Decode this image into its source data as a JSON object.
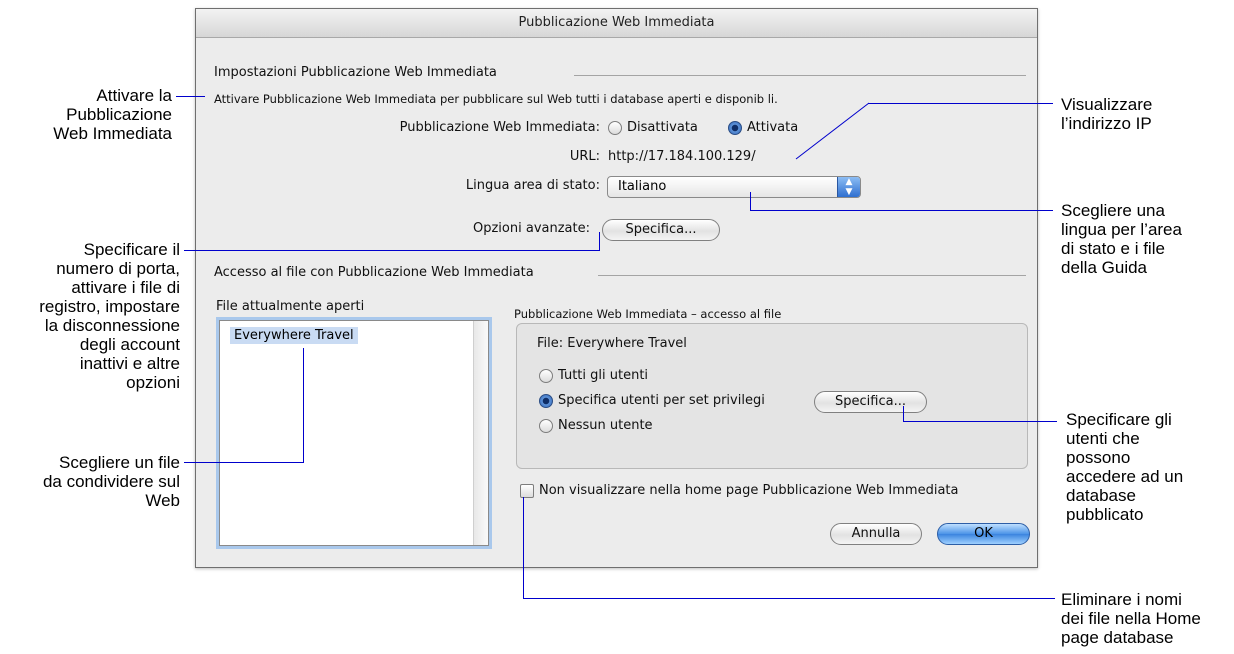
{
  "dialog": {
    "title": "Pubblicazione Web Immediata",
    "section1": {
      "heading": "Impostazioni Pubblicazione Web Immediata",
      "description": "Attivare Pubblicazione Web Immediata per pubblicare sul Web tutti i database aperti e disponib li.",
      "iwp_label": "Pubblicazione Web Immediata:",
      "off_label": "Disattivata",
      "on_label": "Attivata",
      "url_label": "URL:",
      "url_value": "http://17.184.100.129/",
      "language_label": "Lingua area di stato:",
      "language_value": "Italiano",
      "advanced_label": "Opzioni avanzate:",
      "specify_label": "Specifica..."
    },
    "section2": {
      "heading": "Accesso al file con Pubblicazione Web Immediata",
      "open_files_label": "File attualmente aperti",
      "files": [
        "Everywhere Travel"
      ],
      "group_title": "Pubblicazione Web Immediata – accesso al file",
      "file_label": "File: Everywhere Travel",
      "all_users": "Tutti gli utenti",
      "specify_users": "Specifica utenti per set privilegi",
      "specify_button": "Specifica...",
      "no_users": "Nessun utente",
      "hide_checkbox": "Non visualizzare nella home page Pubblicazione Web Immediata"
    },
    "buttons": {
      "cancel": "Annulla",
      "ok": "OK"
    }
  },
  "annotations": {
    "enable": "Attivare la\nPubblicazione\nWeb Immediata",
    "port": "Specificare il\nnumero di porta,\nattivare i file di\nregistro, impostare\nla disconnessione\ndegli account\ninattivi e altre\nopzioni",
    "share": "Scegliere un file\nda condividere sul\nWeb",
    "ip": "Visualizzare\nl’indirizzo IP",
    "language": "Scegliere una\nlingua per l’area\ndi stato e i file\ndella Guida",
    "users": "Specificare gli\nutenti che\npossono\naccedere ad un\ndatabase\npubblicato",
    "hide": "Eliminare i nomi\ndei file nella Home\npage database"
  },
  "colors": {
    "callout_line": "#0000cc",
    "default_button": "#3b84df",
    "selection": "#c9dbf3"
  }
}
